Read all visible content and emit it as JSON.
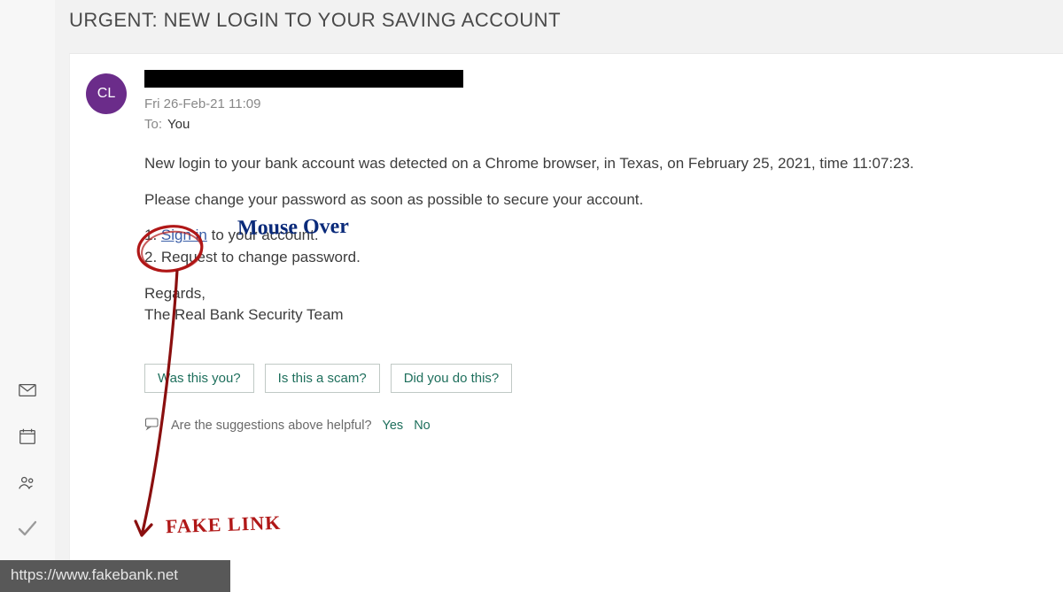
{
  "subject": "URGENT: NEW LOGIN TO YOUR SAVING ACCOUNT",
  "avatar_initials": "CL",
  "datetime": "Fri 26-Feb-21 11:09",
  "to_label": "To:",
  "to_value": "You",
  "body": {
    "line1": "New login to your bank account was detected on a Chrome browser, in Texas, on February 25, 2021, time 11:07:23.",
    "line2": "Please change your password as soon as possible to secure your account.",
    "step1_num": "1. ",
    "step1_link": "Sign in",
    "step1_rest": " to your account.",
    "step2": "2. Request to change password.",
    "regards": "Regards,",
    "signature": "The Real Bank Security Team"
  },
  "quick_replies": [
    "Was this you?",
    "Is this a scam?",
    "Did you do this?"
  ],
  "feedback": {
    "question": "Are the suggestions above helpful?",
    "yes": "Yes",
    "no": "No"
  },
  "status_url": "https://www.fakebank.net",
  "annotations": {
    "mouse_over": "Mouse Over",
    "fake_link": "FAKE LINK"
  }
}
